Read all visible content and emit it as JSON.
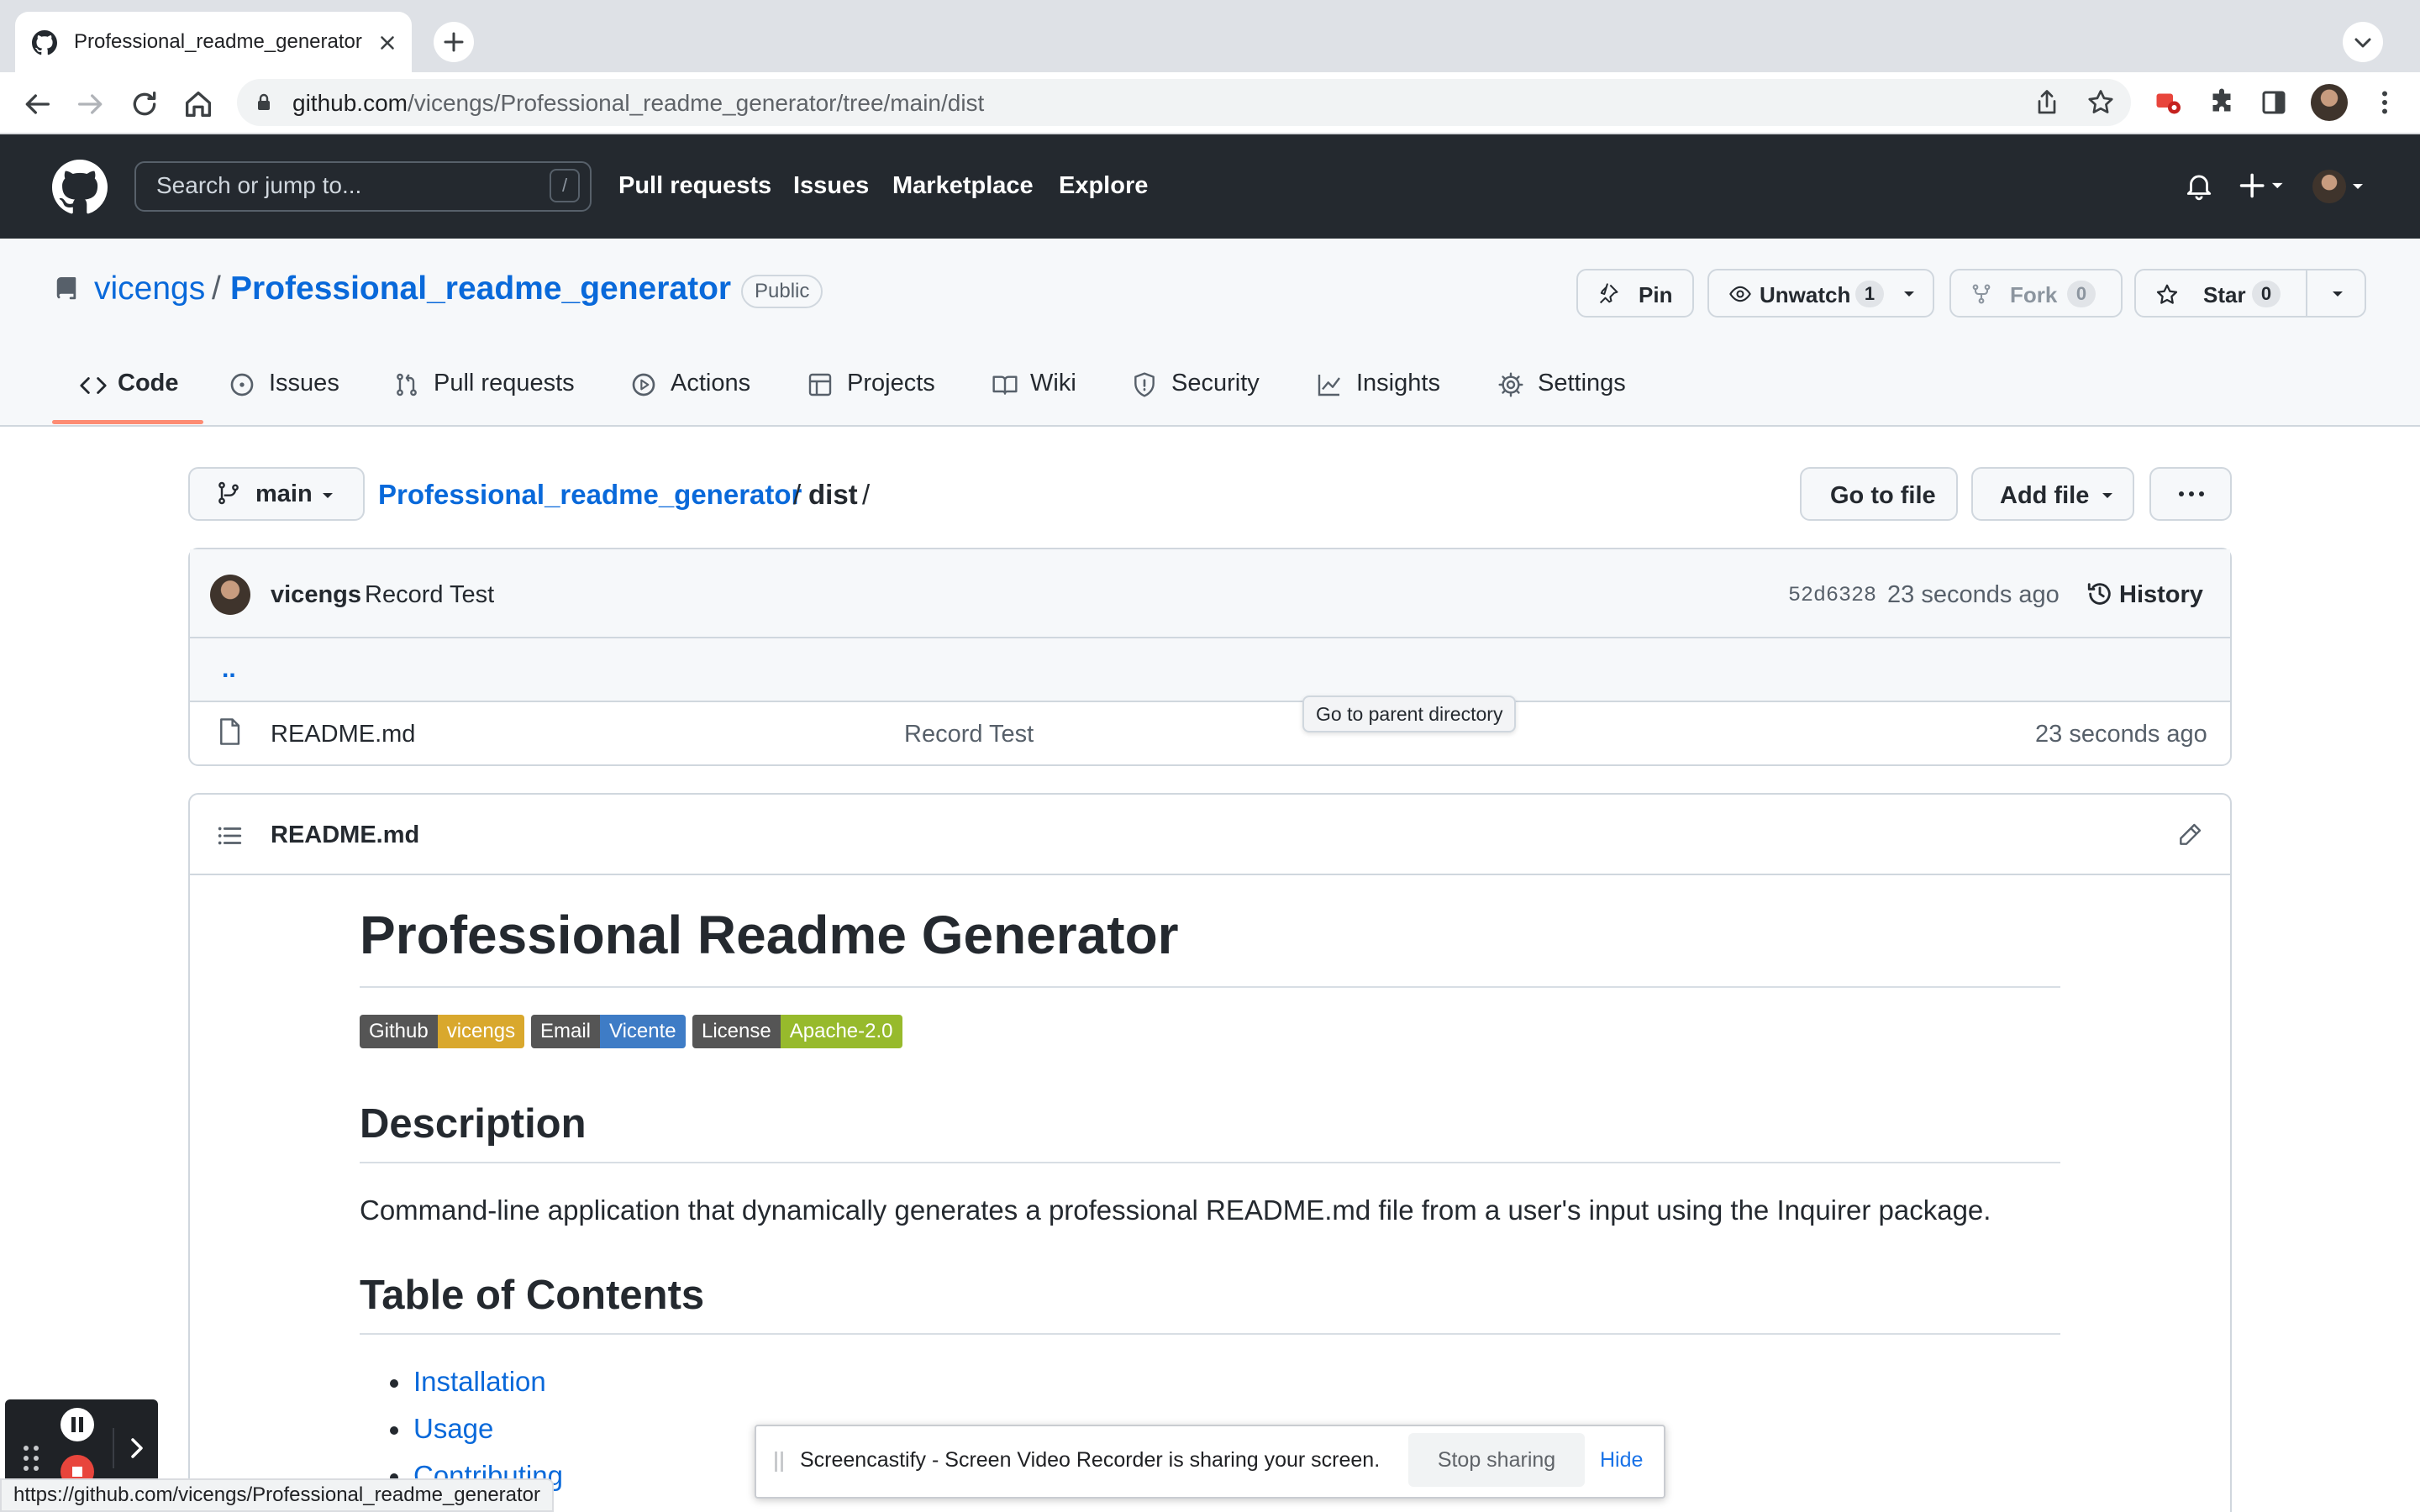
{
  "browser": {
    "tab_title": "Professional_readme_generator",
    "url_domain": "github.com",
    "url_path": "/vicengs/Professional_readme_generator/tree/main/dist"
  },
  "github_header": {
    "search_placeholder": "Search or jump to...",
    "search_shortcut": "/",
    "nav": [
      "Pull requests",
      "Issues",
      "Marketplace",
      "Explore"
    ]
  },
  "repo": {
    "owner": "vicengs",
    "separator": "/",
    "name": "Professional_readme_generator",
    "visibility": "Public",
    "pin_label": "Pin",
    "watch_label": "Unwatch",
    "watch_count": "1",
    "fork_label": "Fork",
    "fork_count": "0",
    "star_label": "Star",
    "star_count": "0"
  },
  "repo_tabs": [
    "Code",
    "Issues",
    "Pull requests",
    "Actions",
    "Projects",
    "Wiki",
    "Security",
    "Insights",
    "Settings"
  ],
  "file_nav": {
    "branch": "main",
    "breadcrumb_repo": "Professional_readme_generator",
    "breadcrumb_sep": "/",
    "breadcrumb_dir": "dist",
    "go_to_file": "Go to file",
    "add_file": "Add file"
  },
  "latest_commit": {
    "author": "vicengs",
    "message": "Record Test",
    "sha": "52d6328",
    "time": "23 seconds ago",
    "history": "History"
  },
  "files": {
    "parent": "..",
    "tooltip": "Go to parent directory",
    "rows": [
      {
        "name": "README.md",
        "message": "Record Test",
        "time": "23 seconds ago"
      }
    ]
  },
  "readme": {
    "filename": "README.md",
    "title": "Professional Readme Generator",
    "badges": [
      {
        "key": "Github",
        "value": "vicengs",
        "color": "#d9a82d"
      },
      {
        "key": "Email",
        "value": "Vicente",
        "color": "#3e7cc6"
      },
      {
        "key": "License",
        "value": "Apache-2.0",
        "color": "#97ba2c"
      }
    ],
    "h_description": "Description",
    "description": "Command-line application that dynamically generates a professional README.md file from a user's input using the Inquirer package.",
    "h_toc": "Table of Contents",
    "toc": [
      "Installation",
      "Usage",
      "Contributing"
    ]
  },
  "overlays": {
    "status_url": "https://github.com/vicengs/Professional_readme_generator",
    "share_text": "Screencastify - Screen Video Recorder is sharing your screen.",
    "stop_sharing": "Stop sharing",
    "hide": "Hide"
  },
  "colors": {
    "link": "#0969da",
    "header_bg": "#24292f",
    "tab_underline": "#fd8c73"
  }
}
